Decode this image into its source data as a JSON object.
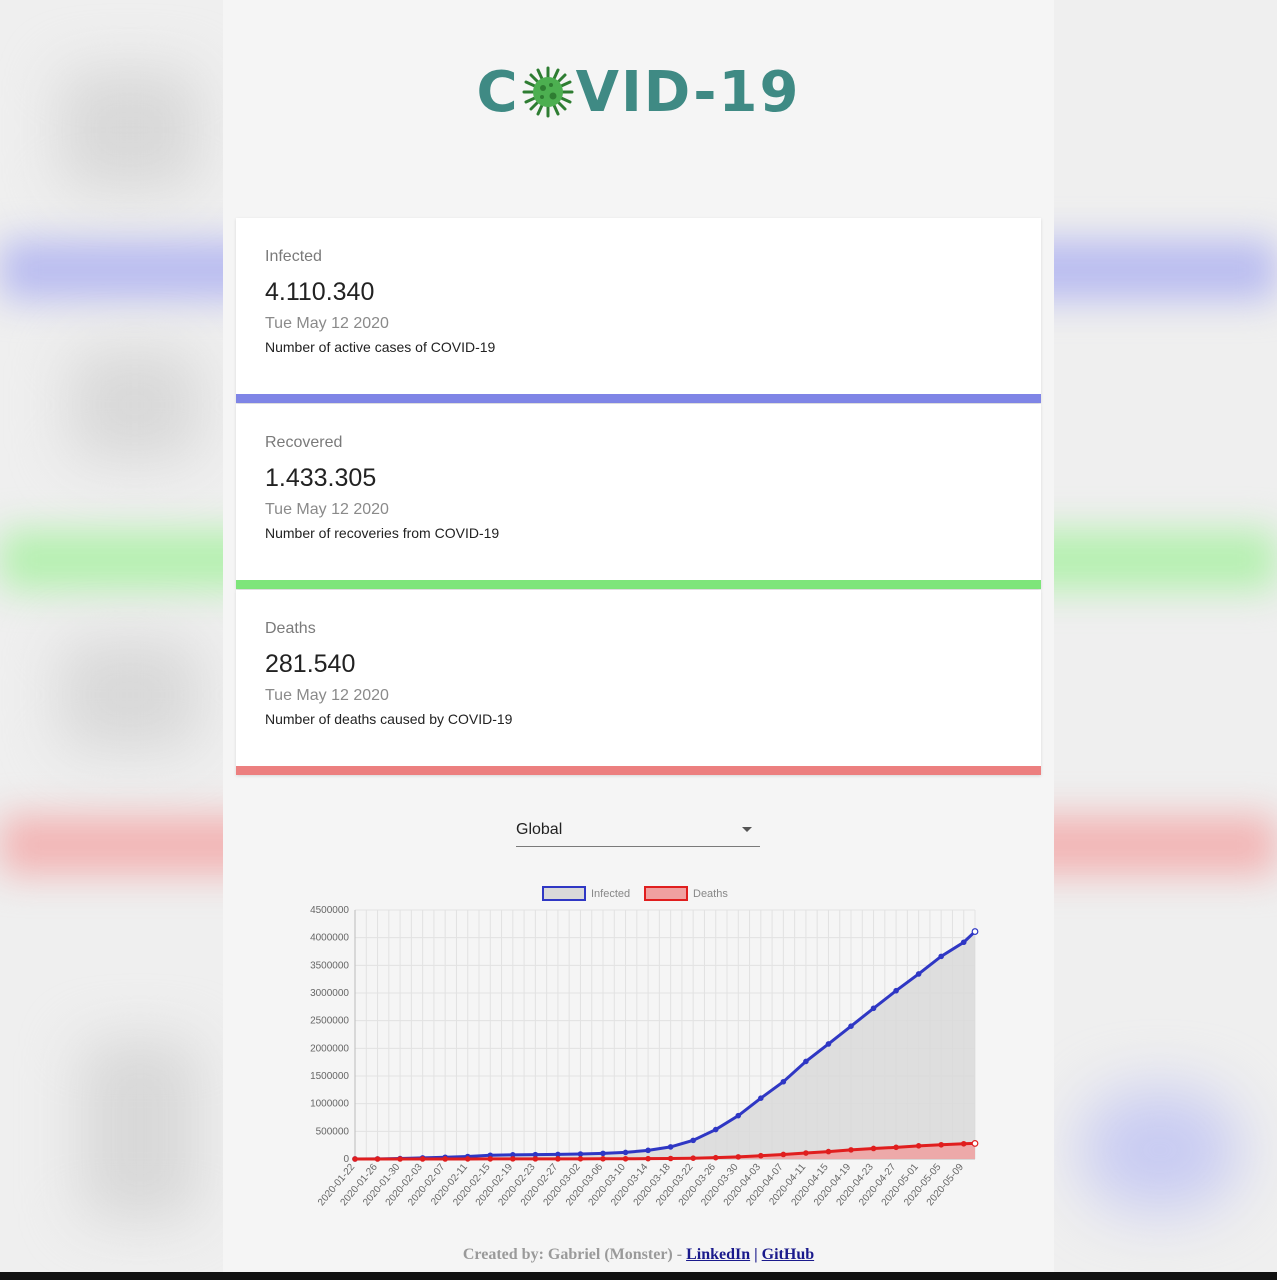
{
  "header": {
    "logo_text_left": "C",
    "logo_text_right": "VID-19",
    "logo_icon": "virus-icon"
  },
  "cards": [
    {
      "label": "Infected",
      "value": "4.110.340",
      "date": "Tue May 12 2020",
      "description": "Number of active cases of COVID-19",
      "color": "#7f85e6"
    },
    {
      "label": "Recovered",
      "value": "1.433.305",
      "date": "Tue May 12 2020",
      "description": "Number of recoveries from COVID-19",
      "color": "#7ee57a"
    },
    {
      "label": "Deaths",
      "value": "281.540",
      "date": "Tue May 12 2020",
      "description": "Number of deaths caused by COVID-19",
      "color": "#ec7f7f"
    }
  ],
  "region_select": {
    "value": "Global"
  },
  "chart_data": {
    "type": "line",
    "title": "",
    "xlabel": "",
    "ylabel": "",
    "ylim": [
      0,
      4500000
    ],
    "yticks": [
      0,
      500000,
      1000000,
      1500000,
      2000000,
      2500000,
      3000000,
      3500000,
      4000000,
      4500000
    ],
    "grid": true,
    "legend_position": "top",
    "x": [
      "2020-01-22",
      "2020-01-26",
      "2020-01-30",
      "2020-02-03",
      "2020-02-07",
      "2020-02-11",
      "2020-02-15",
      "2020-02-19",
      "2020-02-23",
      "2020-02-27",
      "2020-03-02",
      "2020-03-06",
      "2020-03-10",
      "2020-03-14",
      "2020-03-18",
      "2020-03-22",
      "2020-03-26",
      "2020-03-30",
      "2020-04-03",
      "2020-04-07",
      "2020-04-11",
      "2020-04-15",
      "2020-04-19",
      "2020-04-23",
      "2020-04-27",
      "2020-05-01",
      "2020-05-05",
      "2020-05-09"
    ],
    "x_last": "2020-05-11",
    "series": [
      {
        "name": "Infected",
        "color": "#2f37c4",
        "fill": "#d9d9d9",
        "values": [
          600,
          2100,
          8200,
          20000,
          31500,
          44800,
          67100,
          75600,
          78900,
          82700,
          90300,
          101800,
          118900,
          156400,
          218700,
          336800,
          531700,
          783400,
          1099000,
          1396000,
          1763000,
          2079000,
          2400000,
          2724000,
          3041000,
          3344000,
          3662000,
          3917000
        ],
        "last_value": 4110340
      },
      {
        "name": "Deaths",
        "color": "#e01e1e",
        "fill": "#f0a0a0",
        "values": [
          17,
          56,
          170,
          427,
          720,
          1113,
          1666,
          2122,
          2469,
          2811,
          3120,
          3460,
          4262,
          5819,
          8951,
          14640,
          23970,
          38000,
          59000,
          82000,
          108000,
          134000,
          165000,
          190000,
          211000,
          238000,
          257000,
          275000
        ],
        "last_value": 281540
      }
    ]
  },
  "footer": {
    "prefix": "Created by: Gabriel (Monster) - ",
    "link1": "LinkedIn",
    "separator": " | ",
    "link2": "GitHub"
  }
}
